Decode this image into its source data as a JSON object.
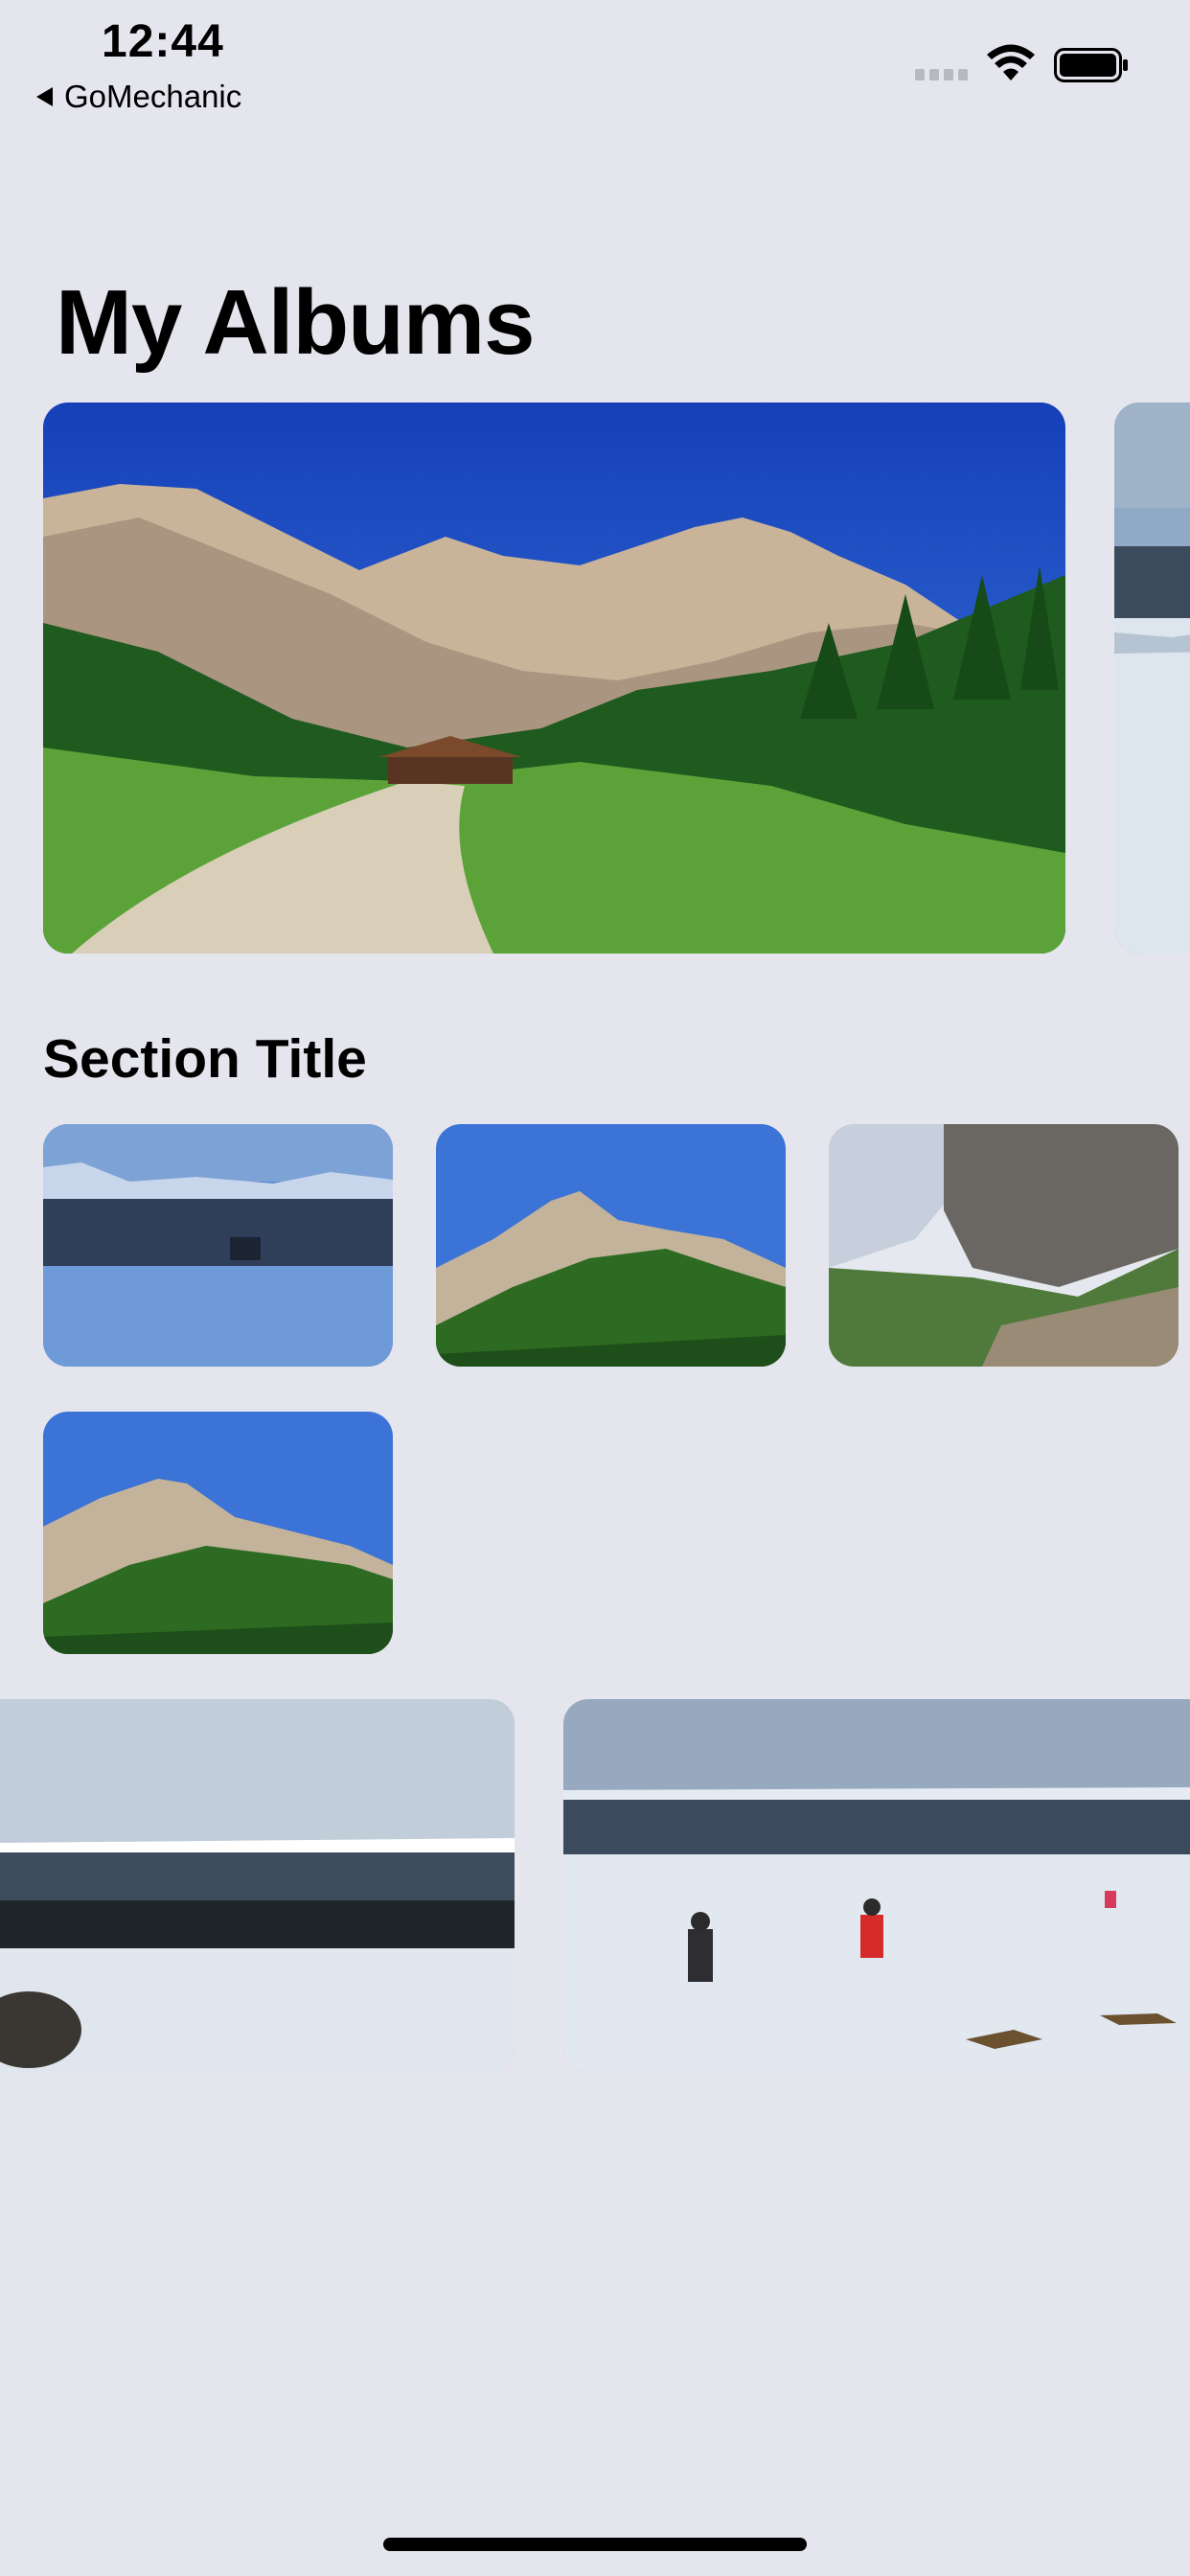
{
  "status_bar": {
    "time": "12:44",
    "back_label": "GoMechanic",
    "icons": [
      "cellular-signal-icon",
      "wifi-icon",
      "battery-icon"
    ]
  },
  "header": {
    "title": "My Albums"
  },
  "section": {
    "title": "Section Title"
  },
  "featured_photos": [
    {
      "name": "alpine-meadow-hut"
    },
    {
      "name": "snowy-lakeshore-partial"
    }
  ],
  "grid_photos": [
    {
      "name": "frozen-lake-cabin"
    },
    {
      "name": "mountain-peak-blue-sky"
    },
    {
      "name": "cliff-face-clouds"
    },
    {
      "name": "mountain-peak-blue-sky-2"
    }
  ],
  "bottom_photos": [
    {
      "name": "coastal-snow-rocks"
    },
    {
      "name": "skiers-on-snow"
    }
  ]
}
